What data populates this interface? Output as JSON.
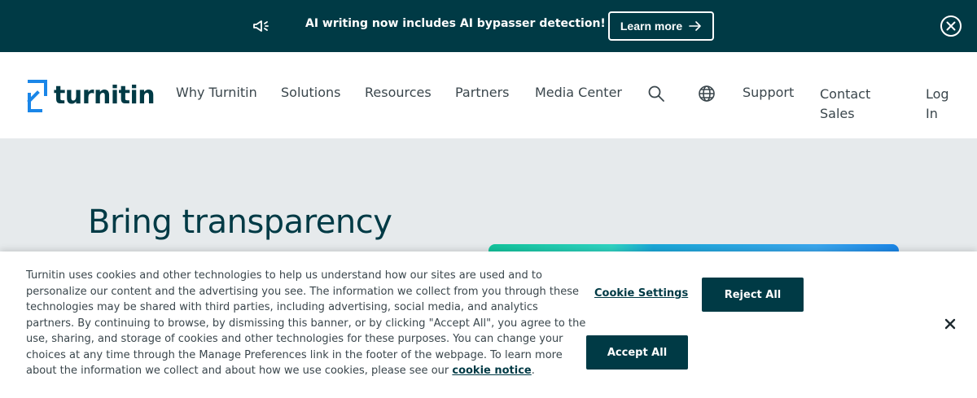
{
  "announcement": {
    "icon": "megaphone-icon",
    "message": "AI writing now includes AI bypasser detection!",
    "learn_more": "Learn more",
    "close_icon": "close-circle-icon"
  },
  "header": {
    "logo_text": "turnitin",
    "nav": [
      "Why Turnitin",
      "Solutions",
      "Resources",
      "Partners",
      "Media Center"
    ],
    "search_icon": "search-icon",
    "globe_icon": "globe-icon",
    "support": "Support",
    "contact_sales": "Contact Sales",
    "log_in": "Log In"
  },
  "hero": {
    "heading": "Bring transparency"
  },
  "cookie": {
    "text": "Turnitin uses cookies and other technologies to help us understand how our sites are used and to personalize our content and the advertising you see. The information we collect from you through these technologies may be shared with third parties, including advertising, social media, and analytics partners. By continuing to browse, by dismissing this banner, or by clicking \"Accept All\", you agree to the use, sharing, and storage of cookies and other technologies for these purposes. You can change your choices at any time through the Manage Preferences link in the footer of the webpage. To learn more about the information we collect and about how we use cookies, please see our ",
    "link": "cookie notice",
    "period": ".",
    "settings": "Cookie Settings",
    "reject": "Reject All",
    "accept": "Accept All"
  },
  "colors": {
    "brand_dark": "#003a45",
    "hero_bg": "#e6eaec",
    "accent_blue": "#1a86e8",
    "accent_teal": "#12c49c"
  }
}
